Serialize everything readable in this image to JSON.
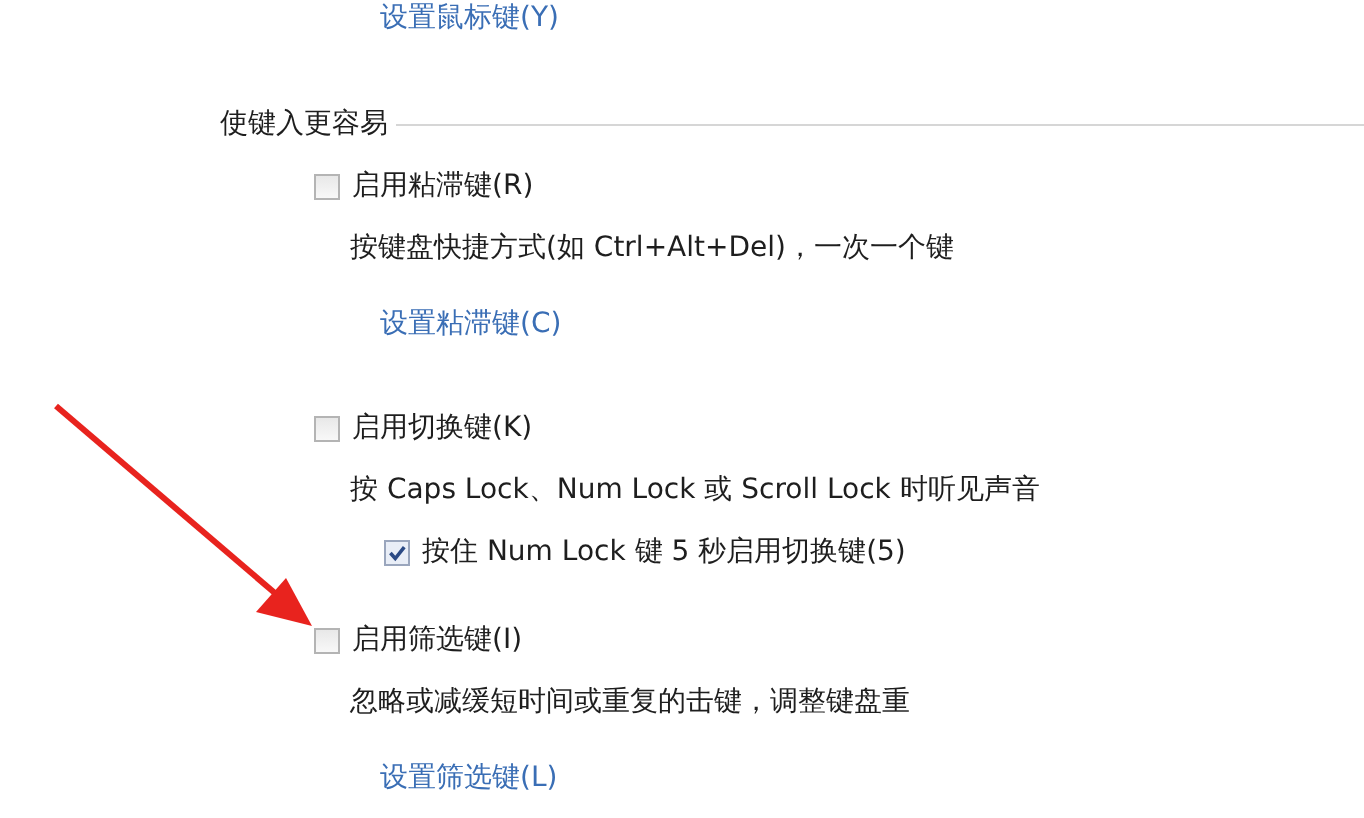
{
  "top_link": "设置鼠标键(Y)",
  "section": {
    "title": "使键入更容易",
    "options": [
      {
        "label": "启用粘滞键(R)",
        "checked": false,
        "description": "按键盘快捷方式(如 Ctrl+Alt+Del)，一次一个键",
        "link": "设置粘滞键(C)"
      },
      {
        "label": "启用切换键(K)",
        "checked": false,
        "description": "按 Caps Lock、Num Lock 或 Scroll Lock 时听见声音",
        "sub_options": [
          {
            "label": "按住 Num Lock 键 5 秒启用切换键(5)",
            "checked": true
          }
        ]
      },
      {
        "label": "启用筛选键(I)",
        "checked": false,
        "description": "忽略或减缓短时间或重复的击键，调整键盘重",
        "link": "设置筛选键(L)"
      }
    ]
  },
  "annotation": {
    "kind": "arrow",
    "color": "#e8231e"
  }
}
